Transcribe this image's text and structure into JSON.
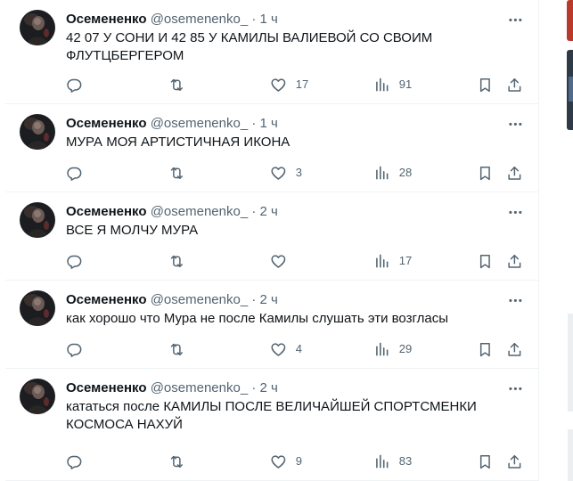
{
  "icons": {
    "reply": "reply-icon",
    "retweet": "retweet-icon",
    "like": "heart-icon",
    "views": "views-icon",
    "bookmark": "bookmark-icon",
    "share": "share-icon",
    "more": "more-icon"
  },
  "colors": {
    "text": "#0f1419",
    "secondary": "#536471",
    "divider": "#eff3f4"
  },
  "tweets": [
    {
      "name": "Осемененко",
      "handle": "@osemenenko_",
      "dot": "·",
      "time": "1 ч",
      "text": "42 07 У СОНИ И 42 85 У КАМИЛЫ ВАЛИЕВОЙ СО СВОИМ ФЛУТЦБЕРГЕРОМ",
      "replies": "",
      "retweets": "",
      "likes": "17",
      "views": "91"
    },
    {
      "name": "Осемененко",
      "handle": "@osemenenko_",
      "dot": "·",
      "time": "1 ч",
      "text": "МУРА МОЯ АРТИСТИЧНАЯ ИКОНА",
      "replies": "",
      "retweets": "",
      "likes": "3",
      "views": "28"
    },
    {
      "name": "Осемененко",
      "handle": "@osemenenko_",
      "dot": "·",
      "time": "2 ч",
      "text": "ВСЕ Я МОЛЧУ МУРА",
      "replies": "",
      "retweets": "",
      "likes": "",
      "views": "17"
    },
    {
      "name": "Осемененко",
      "handle": "@osemenenko_",
      "dot": "·",
      "time": "2 ч",
      "text": "как хорошо что Мура не после Камилы слушать эти возгласы",
      "replies": "",
      "retweets": "",
      "likes": "4",
      "views": "29"
    },
    {
      "name": "Осемененко",
      "handle": "@osemenenko_",
      "dot": "·",
      "time": "2 ч",
      "text": "кататься после КАМИЛЫ ПОСЛЕ ВЕЛИЧАЙШЕЙ СПОРТСМЕНКИ КОСМОСА НАХУЙ",
      "replies": "",
      "retweets": "",
      "likes": "9",
      "views": "83"
    }
  ]
}
